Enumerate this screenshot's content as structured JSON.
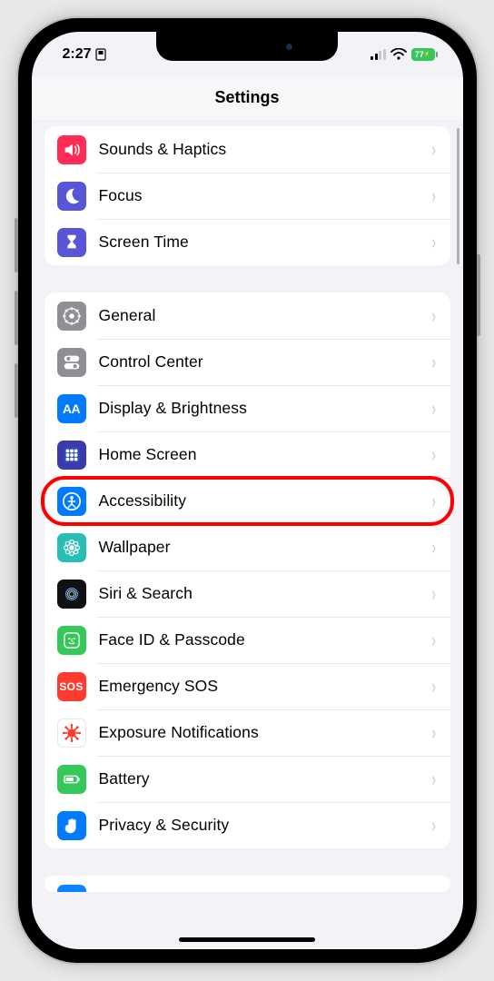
{
  "status": {
    "time": "2:27",
    "battery": "77"
  },
  "title": "Settings",
  "groups": [
    {
      "rows": [
        {
          "name": "sounds-haptics",
          "label": "Sounds & Haptics",
          "icon": "speaker",
          "bg": "#ff2d55"
        },
        {
          "name": "focus",
          "label": "Focus",
          "icon": "moon",
          "bg": "#5856d6"
        },
        {
          "name": "screen-time",
          "label": "Screen Time",
          "icon": "hourglass",
          "bg": "#5856d6"
        }
      ]
    },
    {
      "rows": [
        {
          "name": "general",
          "label": "General",
          "icon": "gear",
          "bg": "#8e8e93"
        },
        {
          "name": "control-center",
          "label": "Control Center",
          "icon": "toggles",
          "bg": "#8e8e93"
        },
        {
          "name": "display",
          "label": "Display & Brightness",
          "icon": "aa",
          "bg": "#007aff"
        },
        {
          "name": "home-screen",
          "label": "Home Screen",
          "icon": "grid",
          "bg": "#3a3aad"
        },
        {
          "name": "accessibility",
          "label": "Accessibility",
          "icon": "person",
          "bg": "#007aff",
          "highlighted": true
        },
        {
          "name": "wallpaper",
          "label": "Wallpaper",
          "icon": "flower",
          "bg": "#27beb6"
        },
        {
          "name": "siri",
          "label": "Siri & Search",
          "icon": "siri",
          "bg": "#111111"
        },
        {
          "name": "faceid",
          "label": "Face ID & Passcode",
          "icon": "face",
          "bg": "#34c759"
        },
        {
          "name": "sos",
          "label": "Emergency SOS",
          "icon": "sos",
          "bg": "#ff3b30"
        },
        {
          "name": "exposure",
          "label": "Exposure Notifications",
          "icon": "virus",
          "bg": "#ffffff"
        },
        {
          "name": "battery",
          "label": "Battery",
          "icon": "batt",
          "bg": "#34c759"
        },
        {
          "name": "privacy",
          "label": "Privacy & Security",
          "icon": "hand",
          "bg": "#007aff"
        }
      ]
    },
    {
      "rows": [
        {
          "name": "next-partial",
          "label": "",
          "icon": "blank",
          "bg": "#0a84ff"
        }
      ]
    }
  ]
}
